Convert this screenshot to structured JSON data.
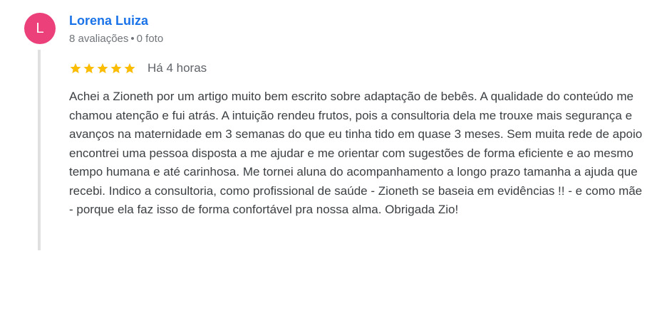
{
  "review": {
    "avatar_letter": "L",
    "avatar_color": "#ec407a",
    "author_name": "Lorena Luiza",
    "author_name_color": "#1a73e8",
    "reviews_count": "8 avaliações",
    "separator": "•",
    "photos_count": "0 foto",
    "rating": 5,
    "rating_max": 5,
    "star_color": "#fbbc04",
    "star_icon": "star-icon",
    "time_ago": "Há 4 horas",
    "text": "Achei a Zioneth por um artigo muito bem escrito sobre adaptação de bebês. A qualidade do conteúdo me chamou atenção e fui atrás. A intuição rendeu frutos, pois a consultoria dela me trouxe mais segurança e avanços na maternidade em 3 semanas do que eu tinha tido em quase 3 meses. Sem muita rede de apoio encontrei uma pessoa disposta a me ajudar e me orientar com sugestões de forma eficiente e ao mesmo tempo humana e até carinhosa. Me tornei aluna do acompanhamento a longo prazo tamanha a ajuda que recebi. Indico a consultoria, como profissional de saúde - Zioneth se baseia em evidências !! - e como mãe - porque ela faz isso de forma confortável pra nossa alma. Obrigada Zio!"
  }
}
